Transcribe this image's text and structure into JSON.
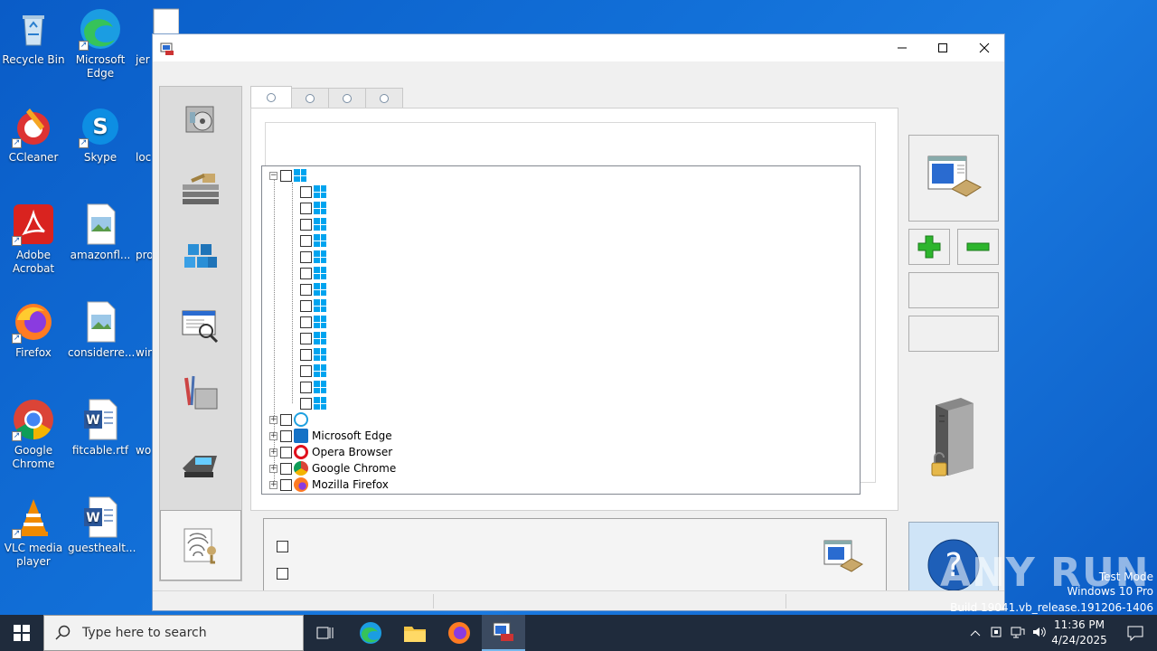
{
  "desktop": {
    "icons": [
      {
        "label": "Recycle Bin"
      },
      {
        "label": "Microsoft Edge"
      },
      {
        "label": "jer"
      },
      {
        "label": "CCleaner"
      },
      {
        "label": "Skype"
      },
      {
        "label": "loc"
      },
      {
        "label": "Adobe Acrobat"
      },
      {
        "label": "amazonfl..."
      },
      {
        "label": "pro"
      },
      {
        "label": "Firefox"
      },
      {
        "label": "considerre..."
      },
      {
        "label": "win"
      },
      {
        "label": "Google Chrome"
      },
      {
        "label": "fitcable.rtf"
      },
      {
        "label": "wo"
      },
      {
        "label": "VLC media player"
      },
      {
        "label": "guesthealt..."
      }
    ]
  },
  "window": {
    "tree": {
      "browsers": [
        {
          "label": ""
        },
        {
          "label": "Microsoft Edge"
        },
        {
          "label": "Opera Browser"
        },
        {
          "label": "Google Chrome"
        },
        {
          "label": "Mozilla Firefox"
        }
      ]
    }
  },
  "taskbar": {
    "search_placeholder": "Type here to search",
    "time": "11:36 PM",
    "date": "4/24/2025"
  },
  "watermark": {
    "line1": "Test Mode",
    "line2": "Windows 10 Pro",
    "line3": "Build 19041.vb_release.191206-1406",
    "brand": "ANY RUN"
  }
}
